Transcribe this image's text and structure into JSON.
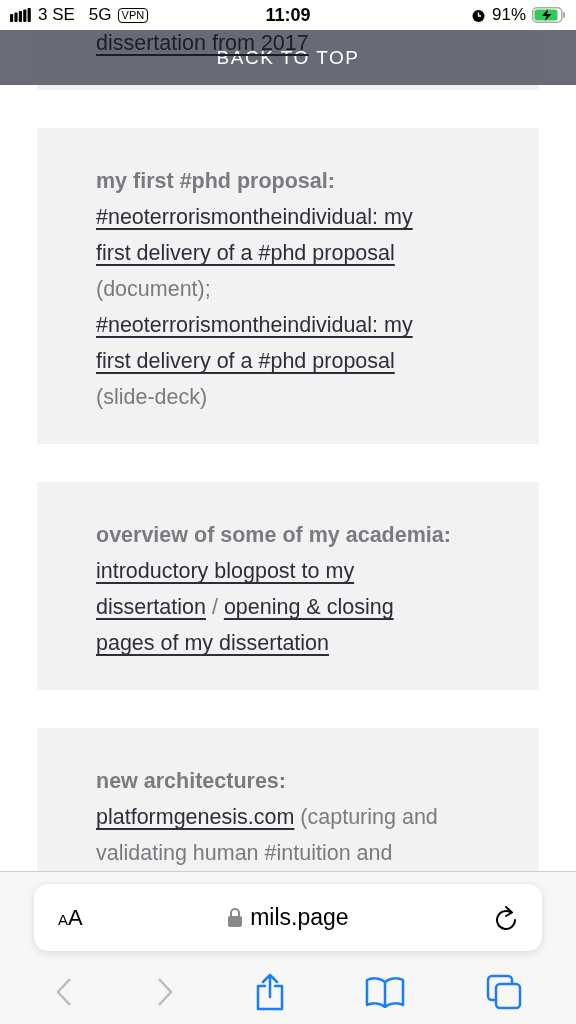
{
  "status_bar": {
    "carrier": "3 SE",
    "network": "5G",
    "vpn": "VPN",
    "time": "11:09",
    "battery": "91%"
  },
  "cards": [
    {
      "lines": [
        [
          {
            "kind": "link",
            "text": "dissertation from 2017"
          }
        ]
      ]
    },
    {
      "lines": [
        [
          {
            "kind": "heading",
            "text": "my first #phd proposal:"
          }
        ],
        [
          {
            "kind": "link",
            "text": "#neoterrorismontheindividual: my"
          }
        ],
        [
          {
            "kind": "link",
            "text": "first delivery of a #phd proposal"
          }
        ],
        [
          {
            "kind": "text",
            "text": "(document);"
          }
        ],
        [
          {
            "kind": "link",
            "text": "#neoterrorismontheindividual: my"
          }
        ],
        [
          {
            "kind": "link",
            "text": "first delivery of a #phd proposal"
          }
        ],
        [
          {
            "kind": "text",
            "text": "(slide-deck)"
          }
        ]
      ]
    },
    {
      "lines": [
        [
          {
            "kind": "heading",
            "text": "overview of some of my academia:"
          }
        ],
        [
          {
            "kind": "link",
            "text": "introductory blogpost to my"
          }
        ],
        [
          {
            "kind": "link",
            "text": "dissertation"
          },
          {
            "kind": "text",
            "text": " / "
          },
          {
            "kind": "link",
            "text": "opening & closing"
          }
        ],
        [
          {
            "kind": "link",
            "text": "pages of my dissertation"
          }
        ]
      ]
    },
    {
      "lines": [
        [
          {
            "kind": "heading",
            "text": "new architectures:"
          }
        ],
        [
          {
            "kind": "link",
            "text": "platformgenesis.com"
          },
          {
            "kind": "text",
            "text": " (capturing and"
          }
        ],
        [
          {
            "kind": "text",
            "text": "validating human #intuition and"
          }
        ]
      ]
    }
  ],
  "back_to_top": "BACK TO TOP",
  "browser": {
    "text_size_small": "A",
    "text_size_large": "A",
    "url": "mils.page"
  }
}
